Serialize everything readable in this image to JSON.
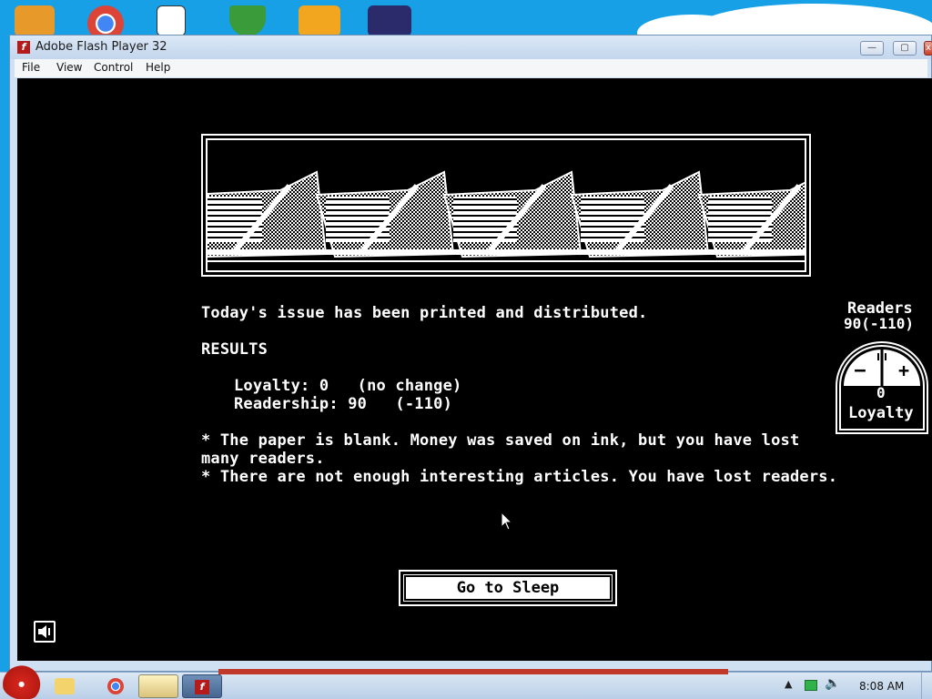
{
  "window": {
    "title": "Adobe Flash Player 32",
    "menu": [
      "File",
      "View",
      "Control",
      "Help"
    ],
    "buttons": {
      "minimize": "—",
      "maximize": "▢",
      "close": "x"
    }
  },
  "game": {
    "headline": "Today's issue has been printed and distributed.",
    "results_heading": "RESULTS",
    "loyalty_line": "Loyalty: 0   (no change)",
    "readership_line": "Readership: 90   (-110)",
    "note1_line1": "* The paper is blank. Money was saved on ink, but you have lost",
    "note1_line2": "many readers.",
    "note2": "* There are not enough interesting articles. You have lost readers.",
    "readers_label": "Readers",
    "readers_value": "90(-110)",
    "loyalty_value": "0",
    "loyalty_label": "Loyalty",
    "gauge_minus": "−",
    "gauge_plus": "+",
    "sleep_button": "Go to Sleep"
  },
  "taskbar": {
    "clock": "8:08 AM"
  },
  "icons": [
    "flash-icon",
    "sound-icon",
    "angry-birds-icon",
    "chrome-icon",
    "folder-icon",
    "network-icon",
    "volume-icon"
  ],
  "colors": {
    "stage": "#000000",
    "foreground": "#ffffff",
    "desktop": "#17a0e6"
  }
}
